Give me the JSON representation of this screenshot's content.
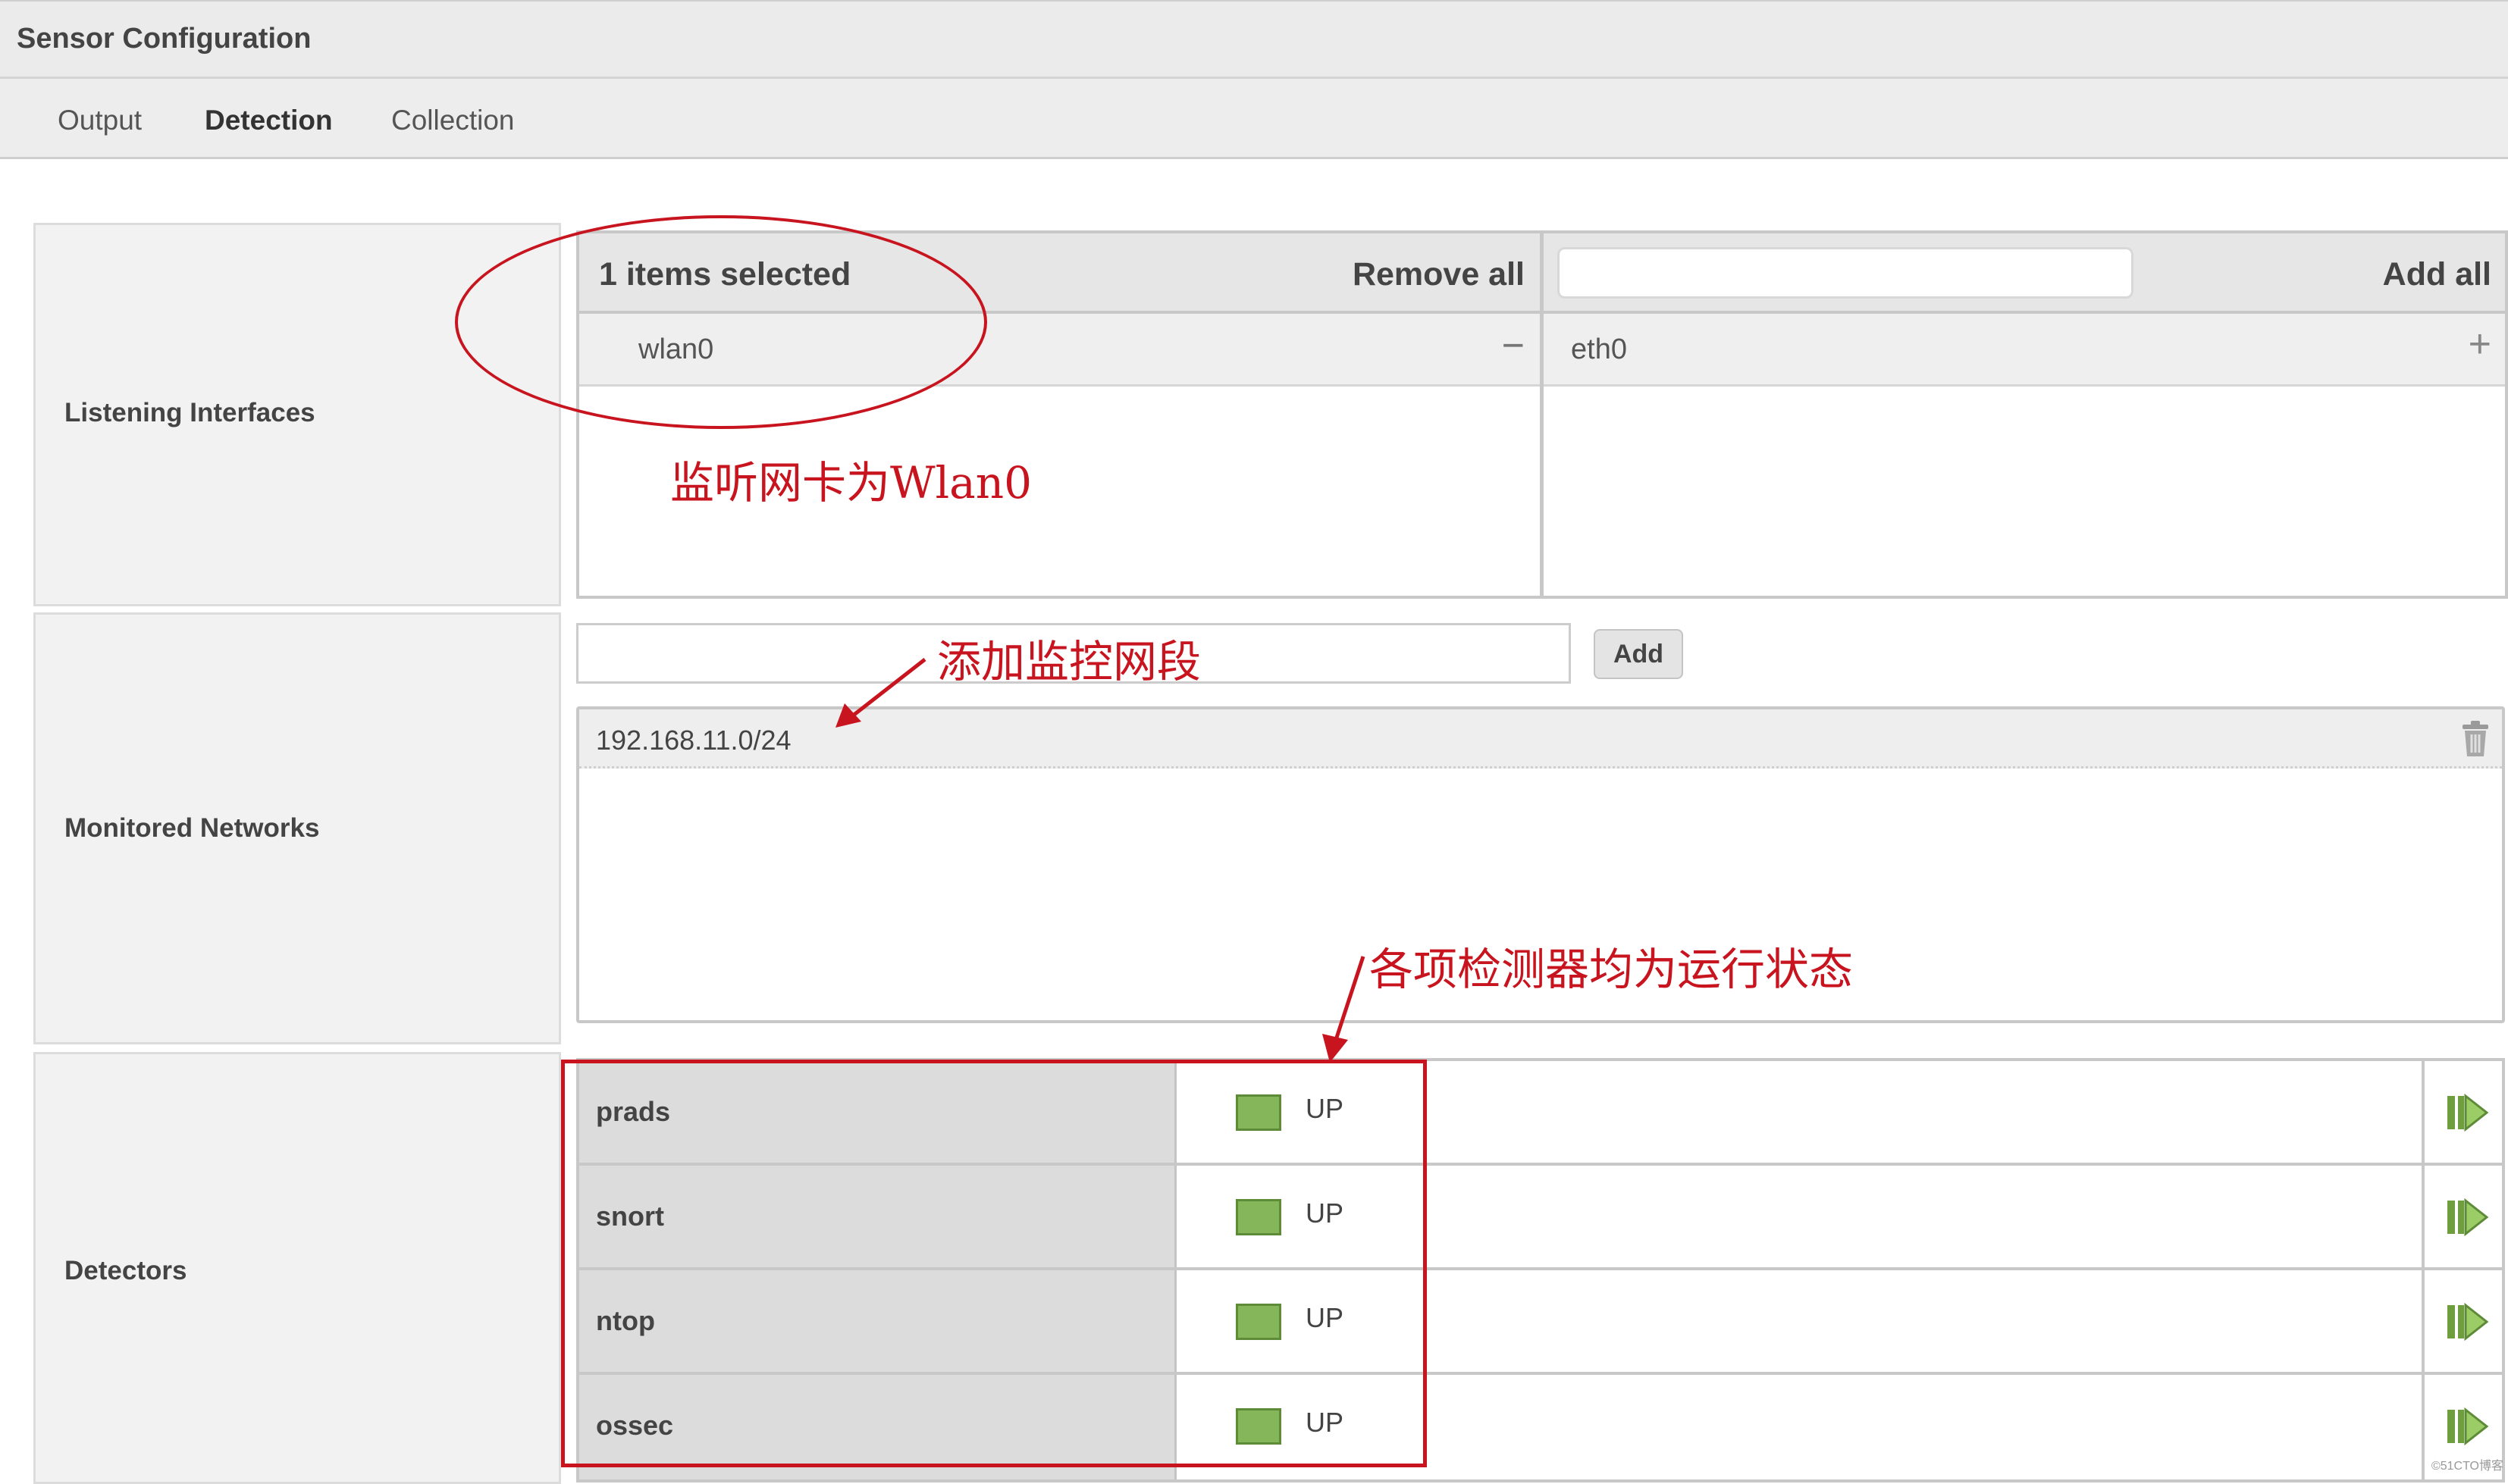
{
  "header": {
    "title": "Sensor Configuration"
  },
  "tabs": [
    {
      "label": "Output",
      "active": false
    },
    {
      "label": "Detection",
      "active": true
    },
    {
      "label": "Collection",
      "active": false
    }
  ],
  "listening_interfaces": {
    "label": "Listening Interfaces",
    "selected_header": "1 items selected",
    "remove_all_label": "Remove all",
    "add_all_label": "Add all",
    "search_value": "",
    "selected_items": [
      {
        "name": "wlan0",
        "action": "−"
      }
    ],
    "available_items": [
      {
        "name": "eth0",
        "action": "+"
      }
    ]
  },
  "monitored_networks": {
    "label": "Monitored Networks",
    "input_value": "",
    "add_label": "Add",
    "networks": [
      "192.168.11.0/24"
    ]
  },
  "detectors": {
    "label": "Detectors",
    "status_color": "#86b65a",
    "items": [
      {
        "name": "prads",
        "status": "UP"
      },
      {
        "name": "snort",
        "status": "UP"
      },
      {
        "name": "ntop",
        "status": "UP"
      },
      {
        "name": "ossec",
        "status": "UP"
      }
    ]
  },
  "annotations": {
    "interface_note": "监听网卡为Wlan0",
    "network_note": "添加监控网段",
    "detector_note": "各项检测器均为运行状态",
    "color": "#c8141e"
  },
  "watermark": "©51CTO博客"
}
